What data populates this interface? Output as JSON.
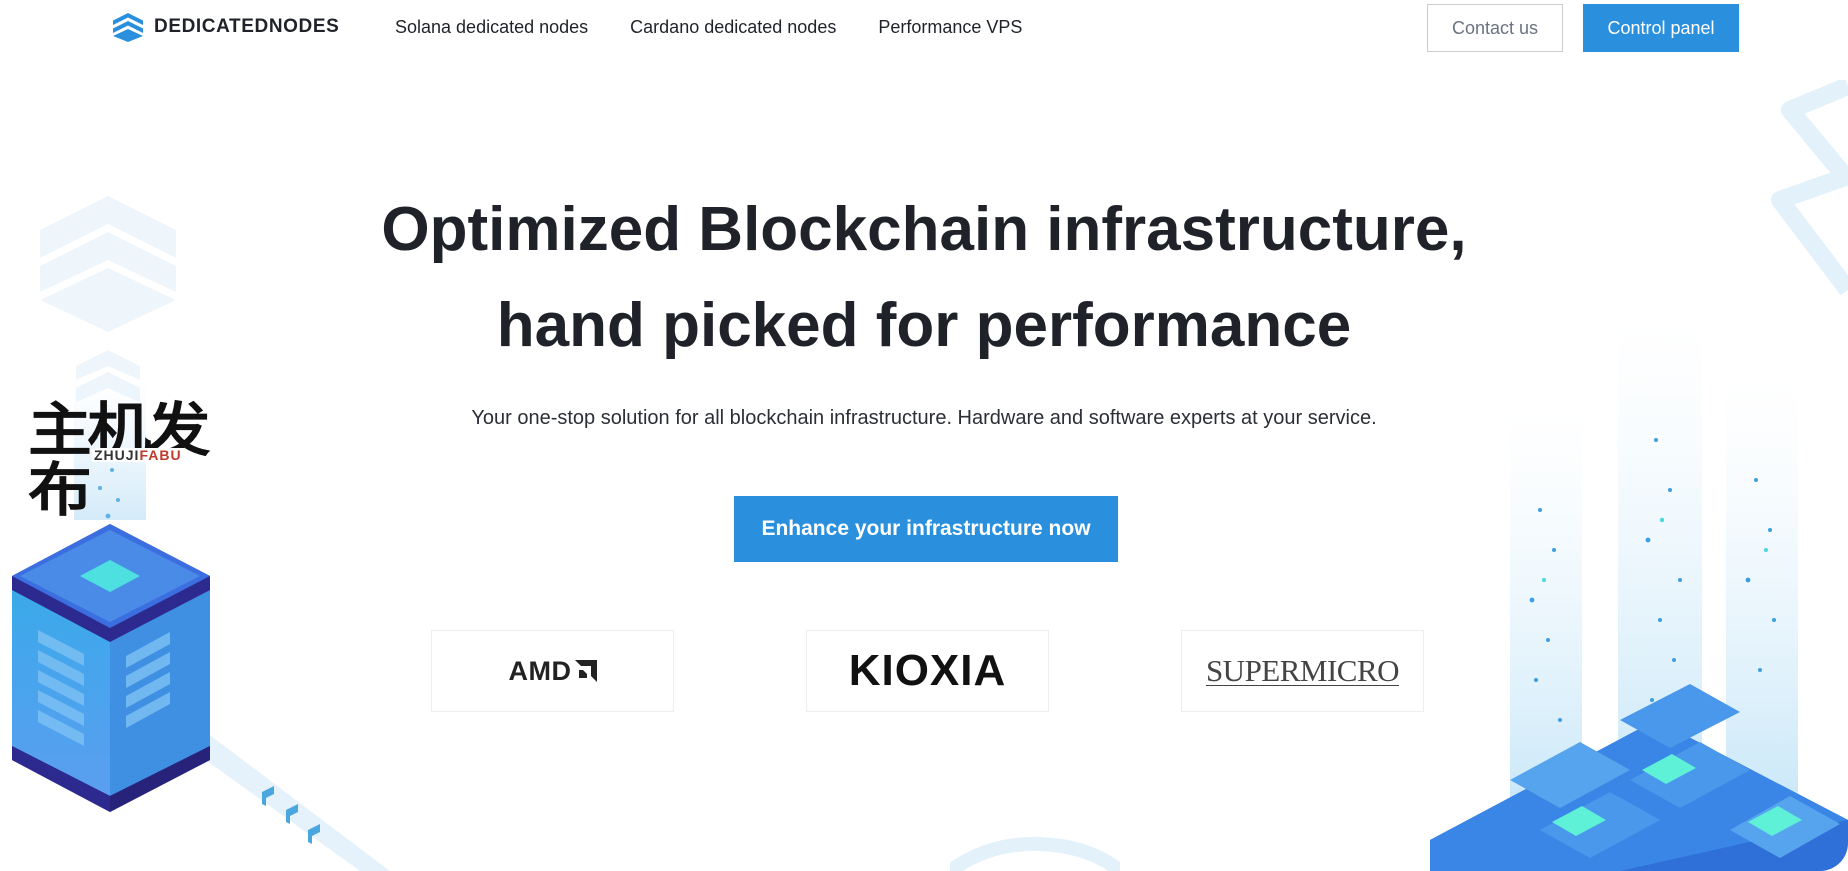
{
  "brand": {
    "name": "DEDICATEDNODES",
    "icon": "stacked-layers-logo-icon"
  },
  "nav": {
    "links": [
      {
        "label": "Solana dedicated nodes"
      },
      {
        "label": "Cardano dedicated nodes"
      },
      {
        "label": "Performance VPS"
      }
    ],
    "contact_label": "Contact us",
    "panel_label": "Control panel"
  },
  "hero": {
    "title_line1": "Optimized Blockchain infrastructure,",
    "title_line2": "hand picked for performance",
    "subtitle": "Your one-stop solution for all blockchain infrastructure. Hardware and software experts at your service.",
    "cta_label": "Enhance your infrastructure now"
  },
  "partners": [
    {
      "name": "AMD"
    },
    {
      "name": "KIOXIA"
    },
    {
      "name": "SUPERMICRO"
    }
  ],
  "watermark": {
    "cn": "主机发布",
    "en_part1": "ZHUJI",
    "en_part2": "FABU"
  },
  "colors": {
    "accent": "#2a8fdc",
    "text": "#1f2329",
    "decor_light": "#e3f1fb",
    "decor_dark": "#2d2a8f"
  }
}
